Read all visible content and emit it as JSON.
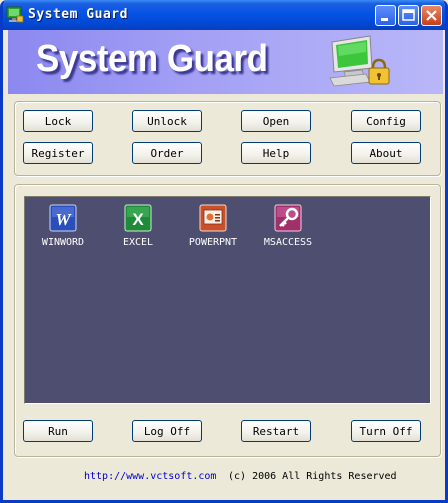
{
  "window": {
    "title": "System Guard"
  },
  "banner": {
    "title": "System Guard"
  },
  "buttons_top": [
    {
      "label": "Lock"
    },
    {
      "label": "Unlock"
    },
    {
      "label": "Open"
    },
    {
      "label": "Config"
    },
    {
      "label": "Register"
    },
    {
      "label": "Order"
    },
    {
      "label": "Help"
    },
    {
      "label": "About"
    }
  ],
  "apps": [
    {
      "label": "WINWORD",
      "icon": "word-icon",
      "color": "#2B4FB8"
    },
    {
      "label": "EXCEL",
      "icon": "excel-icon",
      "color": "#1E8A3A"
    },
    {
      "label": "POWERPNT",
      "icon": "powerpoint-icon",
      "color": "#C8502A"
    },
    {
      "label": "MSACCESS",
      "icon": "access-icon",
      "color": "#A0306A"
    }
  ],
  "buttons_bottom": [
    {
      "label": "Run"
    },
    {
      "label": "Log Off"
    },
    {
      "label": "Restart"
    },
    {
      "label": "Turn Off"
    }
  ],
  "footer": {
    "link": "http://www.vctsoft.com",
    "copyright": "(c) 2006 All Rights Reserved"
  },
  "colors": {
    "titlebar": "#0553E4",
    "banner": "#A4A1F5",
    "desktop": "#4E4F70",
    "link": "#0000CC"
  }
}
